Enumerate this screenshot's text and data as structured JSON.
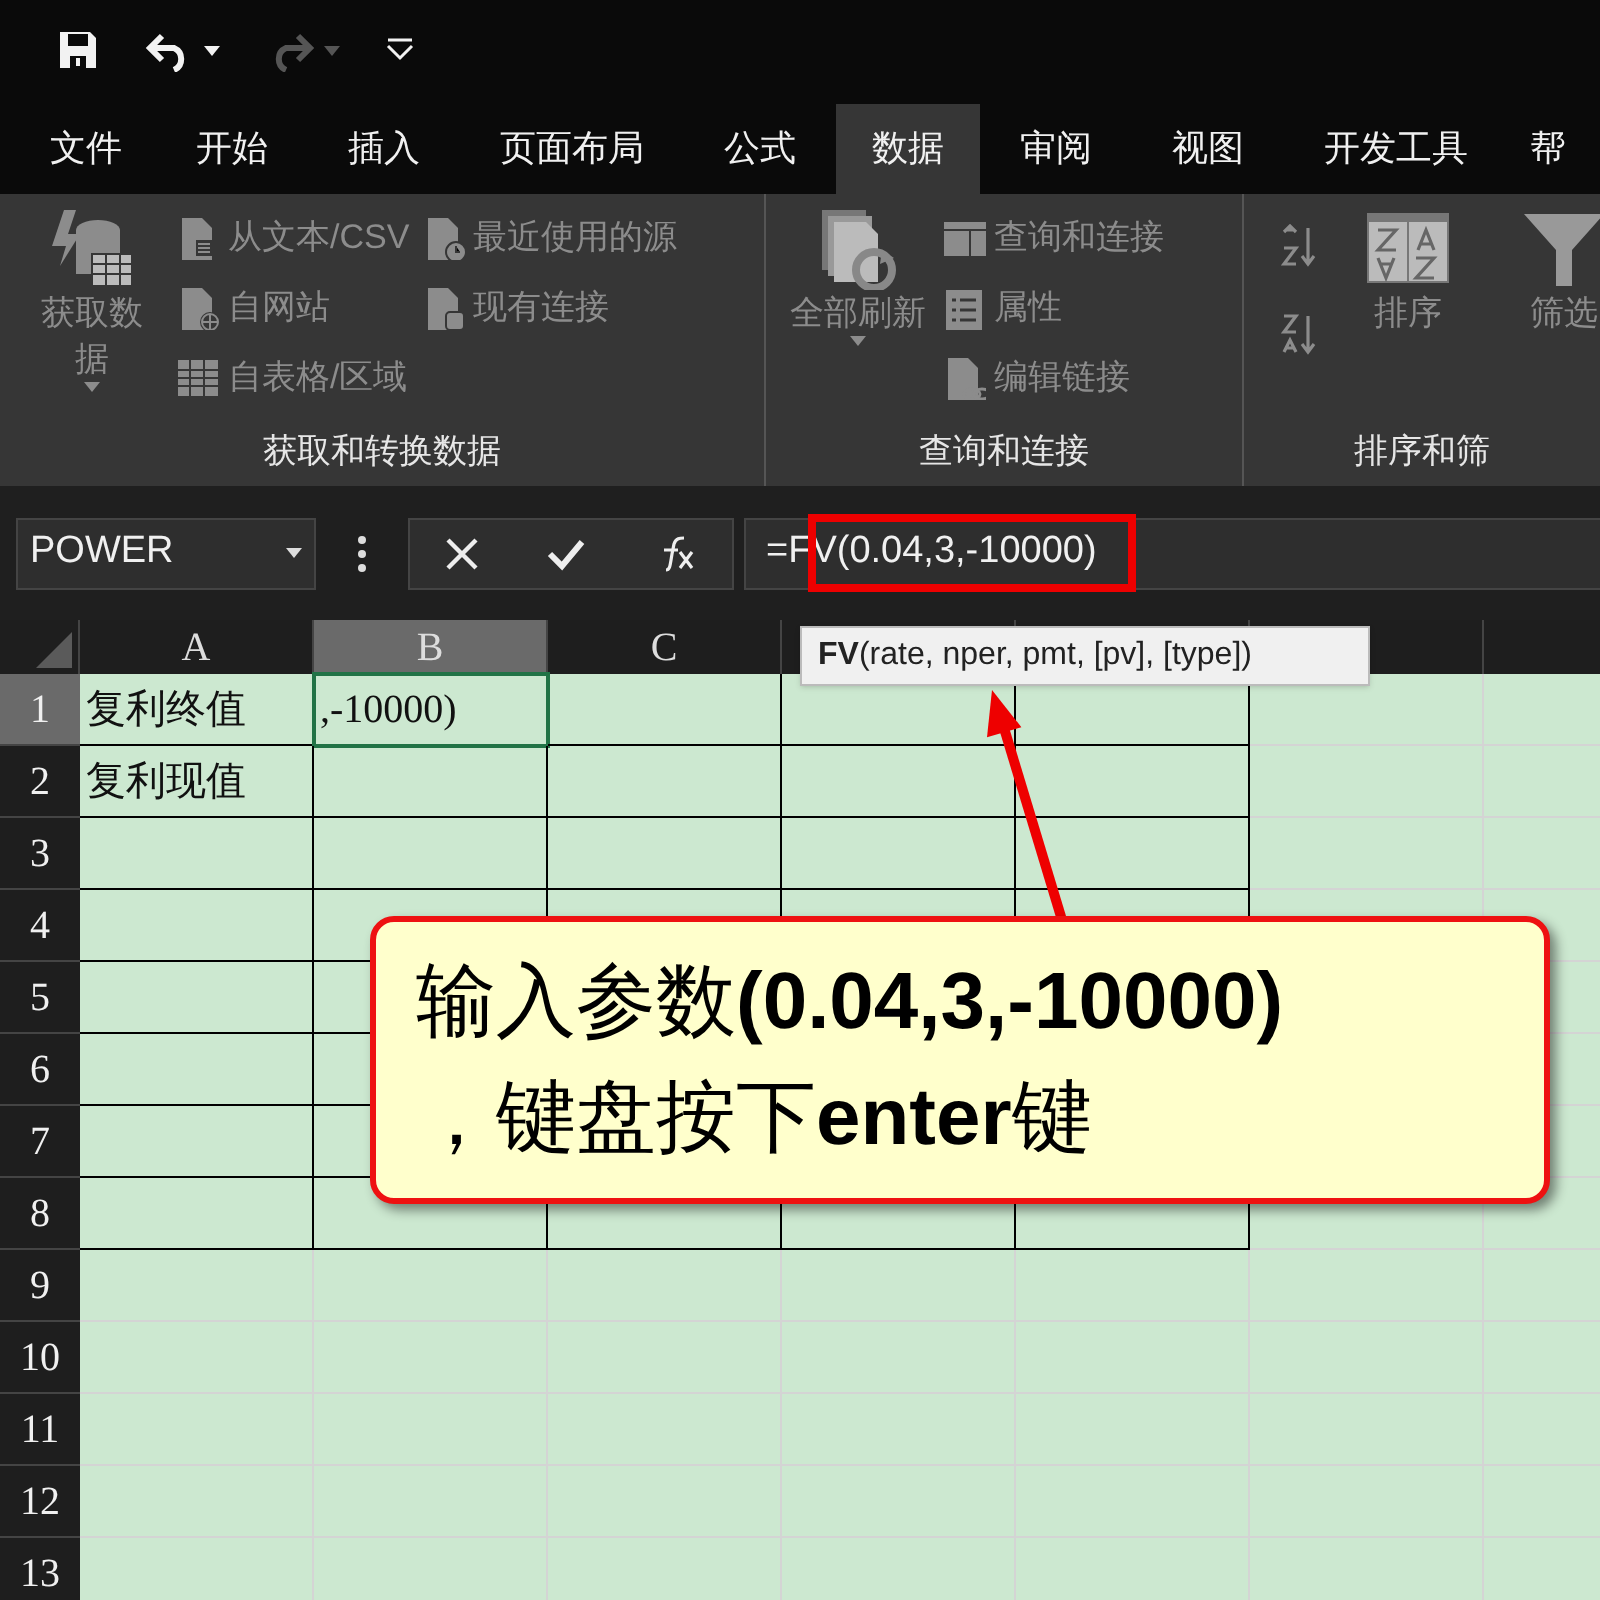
{
  "quick_access": [
    {
      "kind": "save",
      "disabled": false
    },
    {
      "kind": "undo",
      "disabled": false,
      "menu": true
    },
    {
      "kind": "redo",
      "disabled": true,
      "menu": true
    },
    {
      "kind": "customize",
      "disabled": false
    }
  ],
  "tabs": [
    {
      "label": "文件",
      "selected": false
    },
    {
      "label": "开始",
      "selected": false
    },
    {
      "label": "插入",
      "selected": false
    },
    {
      "label": "页面布局",
      "selected": false
    },
    {
      "label": "公式",
      "selected": false
    },
    {
      "label": "数据",
      "selected": true
    },
    {
      "label": "审阅",
      "selected": false
    },
    {
      "label": "视图",
      "selected": false
    },
    {
      "label": "开发工具",
      "selected": false
    },
    {
      "label": "帮",
      "selected": false
    }
  ],
  "ribbon": {
    "groups": [
      {
        "label": "获取和转换数据",
        "columns": [
          [
            {
              "kind": "large",
              "label": "获取数据",
              "disabled": true,
              "menu": true
            }
          ],
          [
            {
              "kind": "small",
              "label": "从文本/CSV",
              "disabled": true
            },
            {
              "kind": "small",
              "label": "自网站",
              "disabled": true
            },
            {
              "kind": "small",
              "label": "自表格/区域",
              "disabled": true
            }
          ],
          [
            {
              "kind": "small",
              "label": "最近使用的源",
              "disabled": true
            },
            {
              "kind": "small",
              "label": "现有连接",
              "disabled": true
            }
          ]
        ]
      },
      {
        "label": "查询和连接",
        "columns": [
          [
            {
              "kind": "large",
              "label": "全部刷新",
              "disabled": true,
              "menu": true
            }
          ],
          [
            {
              "kind": "small",
              "label": "查询和连接",
              "disabled": true
            },
            {
              "kind": "small",
              "label": "属性",
              "disabled": true
            },
            {
              "kind": "small",
              "label": "编辑链接",
              "disabled": true
            }
          ]
        ]
      },
      {
        "label": "排序和筛",
        "columns": [
          [
            {
              "kind": "icon",
              "disabled": true
            },
            {
              "kind": "icon",
              "disabled": true
            }
          ],
          [
            {
              "kind": "large",
              "label": "排序",
              "disabled": true
            }
          ],
          [
            {
              "kind": "large",
              "label": "筛选",
              "disabled": true
            }
          ]
        ]
      }
    ]
  },
  "formula_bar": {
    "name_box": "POWER",
    "formula": "=FV(0.04,3,-10000)",
    "tooltip": "**FV**(rate, nper, pmt, [pv], [type])"
  },
  "sheet": {
    "columns": [
      {
        "label": "A",
        "selected": false
      },
      {
        "label": "B",
        "selected": true
      },
      {
        "label": "C",
        "selected": false
      },
      {
        "selected": false
      },
      {
        "selected": false
      },
      {
        "selected": false
      },
      {
        "selected": false
      }
    ],
    "rows": [
      {
        "number": "1",
        "selected": true,
        "bordered": true,
        "cells": [
          {
            "text": "复利终值",
            "active": false
          },
          {
            "text": ",-10000)",
            "active": true
          }
        ]
      },
      {
        "number": "2",
        "selected": false,
        "bordered": true,
        "cells": [
          {
            "text": "复利现值",
            "active": false
          }
        ]
      },
      {
        "number": "3",
        "selected": false,
        "bordered": true
      },
      {
        "number": "4",
        "selected": false,
        "bordered": true
      },
      {
        "number": "5",
        "selected": false,
        "bordered": true
      },
      {
        "number": "6",
        "selected": false,
        "bordered": true
      },
      {
        "number": "7",
        "selected": false,
        "bordered": true
      },
      {
        "number": "8",
        "selected": false,
        "bordered": true
      },
      {
        "number": "9",
        "selected": false,
        "bordered": false
      },
      {
        "number": "10",
        "selected": false,
        "bordered": false
      },
      {
        "number": "11",
        "selected": false,
        "bordered": false
      },
      {
        "number": "12",
        "selected": false,
        "bordered": false
      },
      {
        "number": "13",
        "selected": false,
        "bordered": false
      }
    ]
  },
  "callout": {
    "lines": [
      "输入参数**(0.04,3,-10000)**",
      "，键盘按下**enter**键"
    ]
  }
}
